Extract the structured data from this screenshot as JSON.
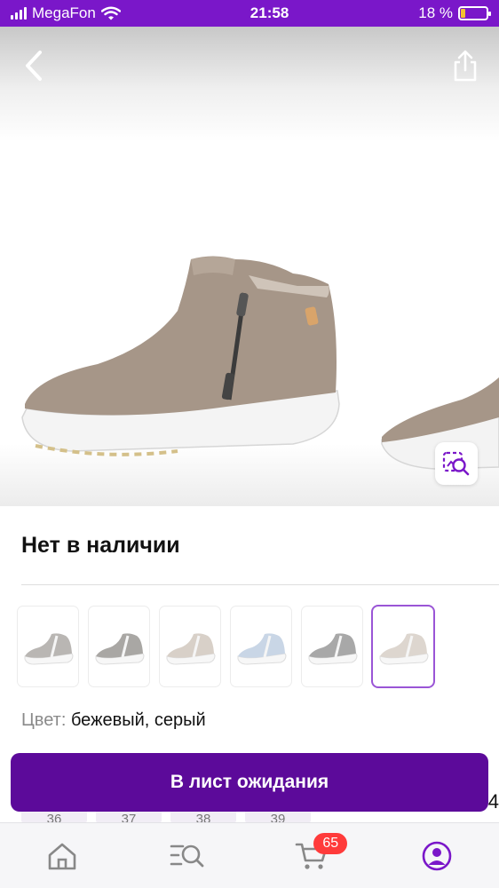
{
  "status_bar": {
    "carrier": "MegaFon",
    "time": "21:58",
    "battery_percent_label": "18 %",
    "battery_level": 0.18
  },
  "header": {
    "back_icon": "chevron-left-icon",
    "share_icon": "share-icon"
  },
  "gallery": {
    "zoom_icon": "image-search-icon"
  },
  "product": {
    "availability": "Нет в наличии",
    "color_label": "Цвет:",
    "color_value": "бежевый, серый",
    "variant_count": 6,
    "selected_variant_index": 5
  },
  "sizes": [
    "36",
    "37",
    "38",
    "39"
  ],
  "size_edge": "4",
  "cta": {
    "label": "В лист ожидания"
  },
  "tab_bar": {
    "tabs": [
      {
        "name": "home",
        "icon": "home-icon"
      },
      {
        "name": "catalog",
        "icon": "catalog-search-icon"
      },
      {
        "name": "cart",
        "icon": "cart-icon",
        "badge": "65"
      },
      {
        "name": "profile",
        "icon": "profile-icon"
      }
    ]
  },
  "colors": {
    "brand": "#7a17c9",
    "cta": "#5c0a9a",
    "badge": "#ff3b3b",
    "accent": "#9a55d6"
  }
}
